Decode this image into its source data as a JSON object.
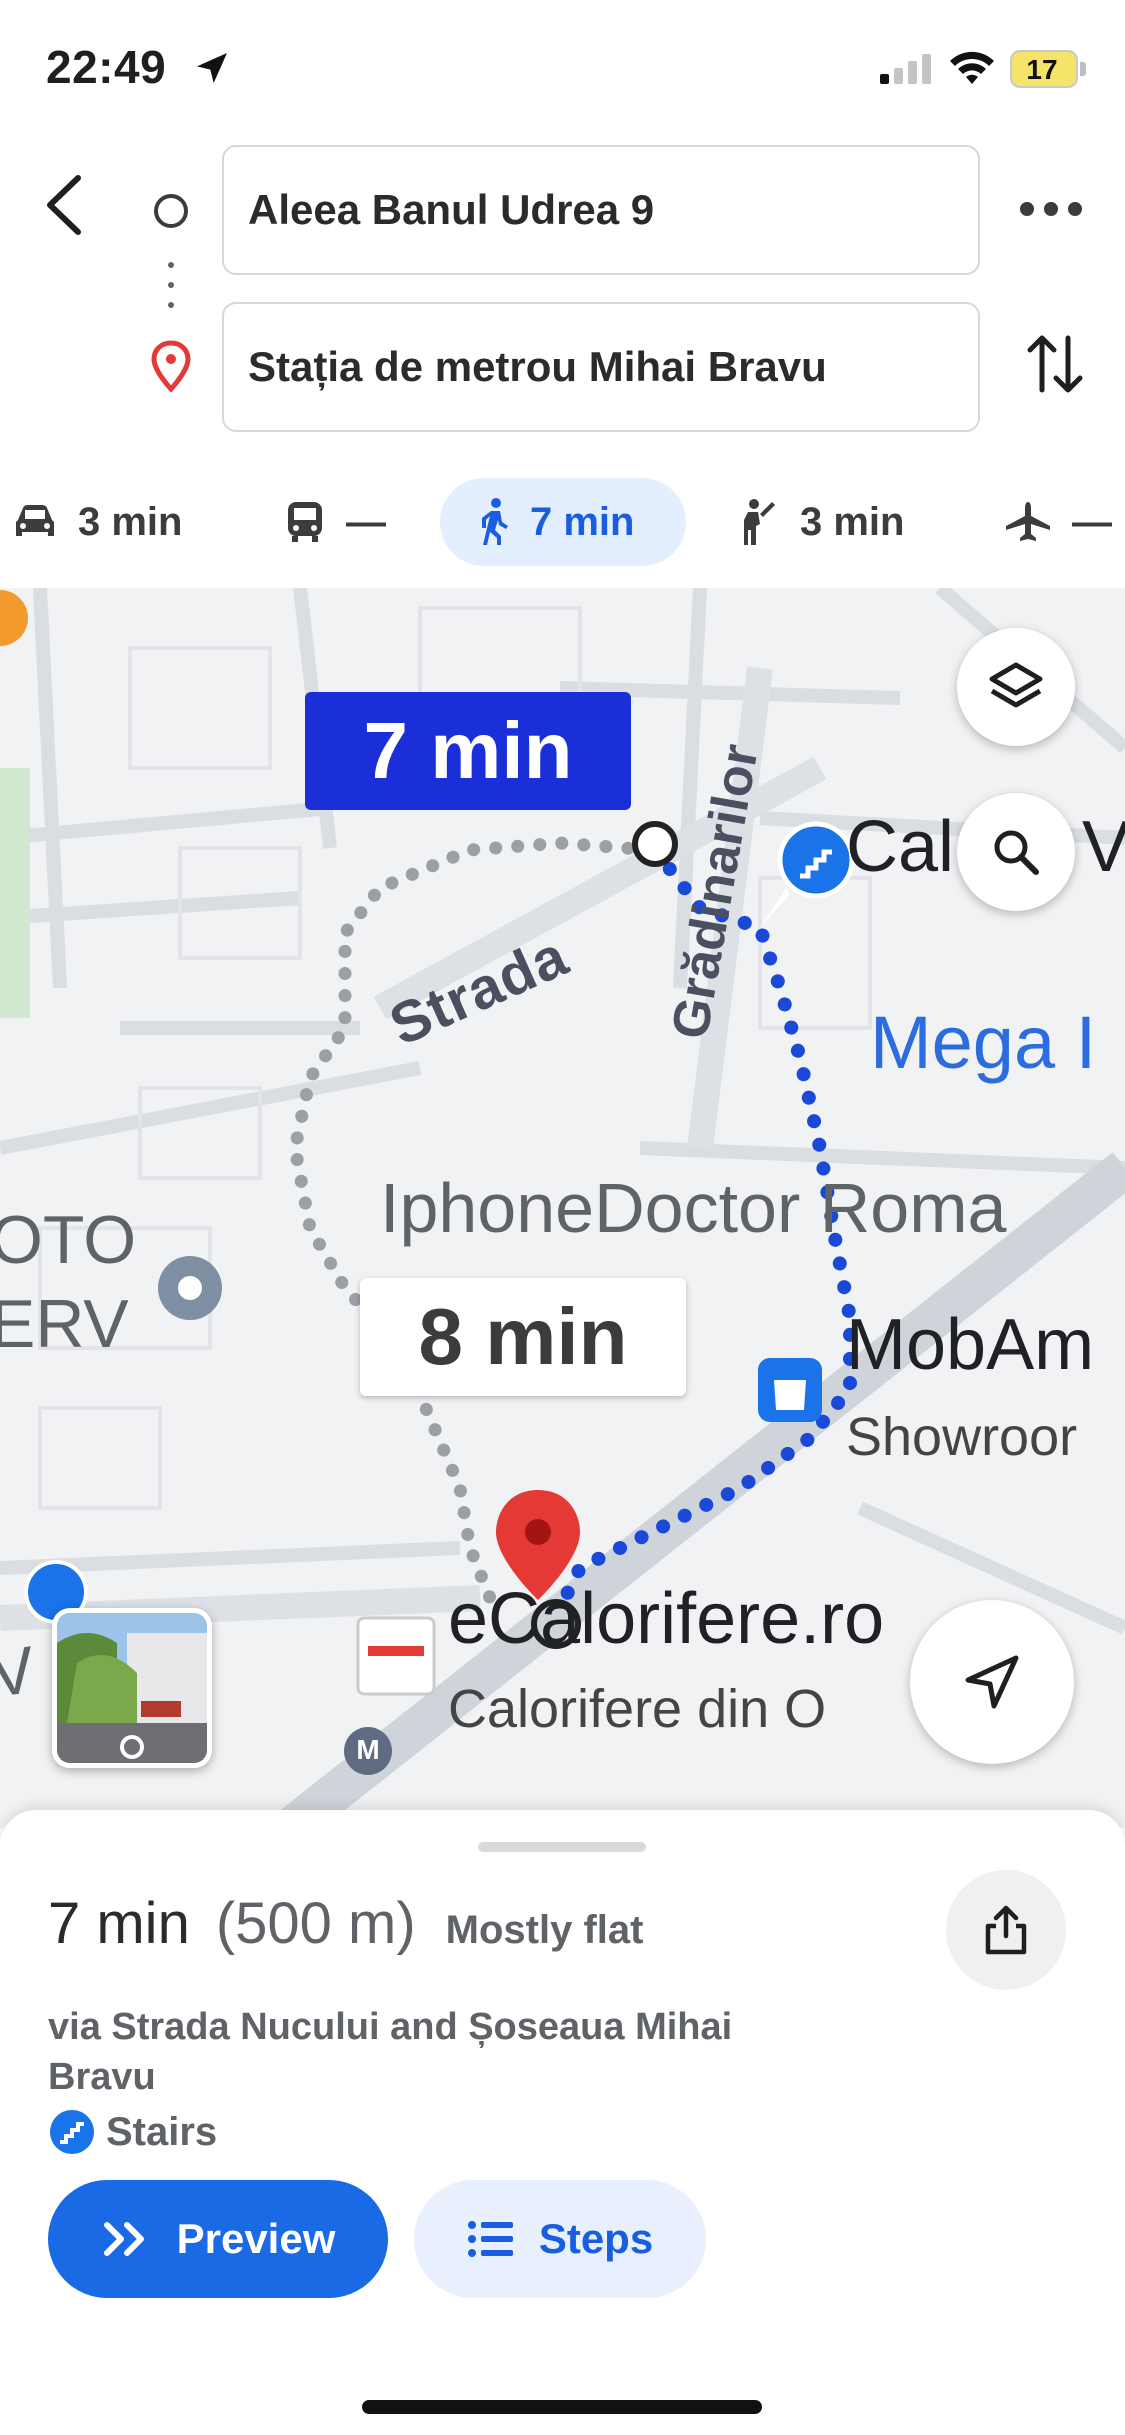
{
  "status_bar": {
    "time": "22:49",
    "battery": "17"
  },
  "route": {
    "origin": "Aleea Banul Udrea 9",
    "destination": "Stația de metrou Mihai Bravu"
  },
  "modes": [
    {
      "icon": "car-icon",
      "time": "3 min"
    },
    {
      "icon": "transit-icon",
      "time": "—"
    },
    {
      "icon": "walk-icon",
      "time": "7 min",
      "selected": true
    },
    {
      "icon": "rideshare-icon",
      "time": "3 min"
    },
    {
      "icon": "flight-icon",
      "time": "—"
    }
  ],
  "map": {
    "time_primary": "7 min",
    "time_alt": "8 min",
    "labels": {
      "strada": "Strada",
      "gradinarilor": "Grădinarilor",
      "cal": "Cal",
      "v": "V",
      "mega": "Mega I",
      "iphone": "IphoneDoctor Roma",
      "oto_1": "OTO",
      "oto_2": "ERV",
      "mobam": "MobAm",
      "showroom": "Showroor",
      "ecal": "eCalorifere.ro",
      "calorifere": "Calorifere din O",
      "vor": "V    or",
      "metro": "M"
    },
    "colors": {
      "route_primary": "#1a49d8",
      "route_alt": "#9aa0a6",
      "pin": "#e53935"
    }
  },
  "sheet": {
    "time": "7 min",
    "distance": "(500 m)",
    "terrain": "Mostly flat",
    "via": "via Strada Nucului and Șoseaua Mihai Bravu",
    "warning": "Stairs",
    "preview_label": "Preview",
    "steps_label": "Steps"
  }
}
